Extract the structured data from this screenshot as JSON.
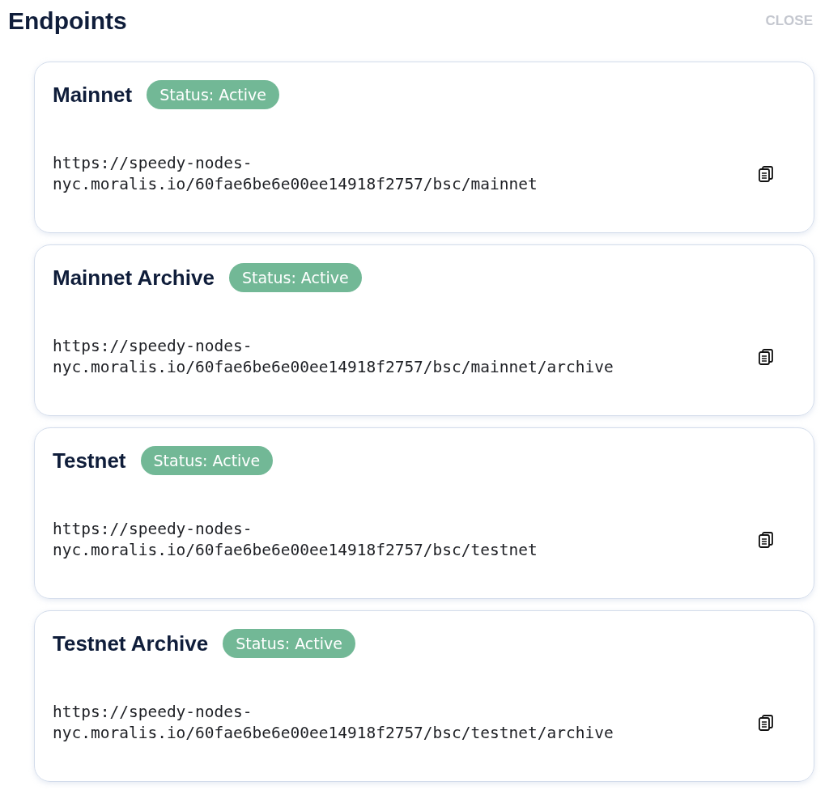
{
  "title": "Endpoints",
  "close": "CLOSE",
  "endpoints": [
    {
      "name": "Mainnet",
      "status": "Status: Active",
      "url": "https://speedy-nodes-nyc.moralis.io/60fae6be6e00ee14918f2757/bsc/mainnet"
    },
    {
      "name": "Mainnet Archive",
      "status": "Status: Active",
      "url": "https://speedy-nodes-nyc.moralis.io/60fae6be6e00ee14918f2757/bsc/mainnet/archive"
    },
    {
      "name": "Testnet",
      "status": "Status: Active",
      "url": "https://speedy-nodes-nyc.moralis.io/60fae6be6e00ee14918f2757/bsc/testnet"
    },
    {
      "name": "Testnet Archive",
      "status": "Status: Active",
      "url": "https://speedy-nodes-nyc.moralis.io/60fae6be6e00ee14918f2757/bsc/testnet/archive"
    }
  ]
}
